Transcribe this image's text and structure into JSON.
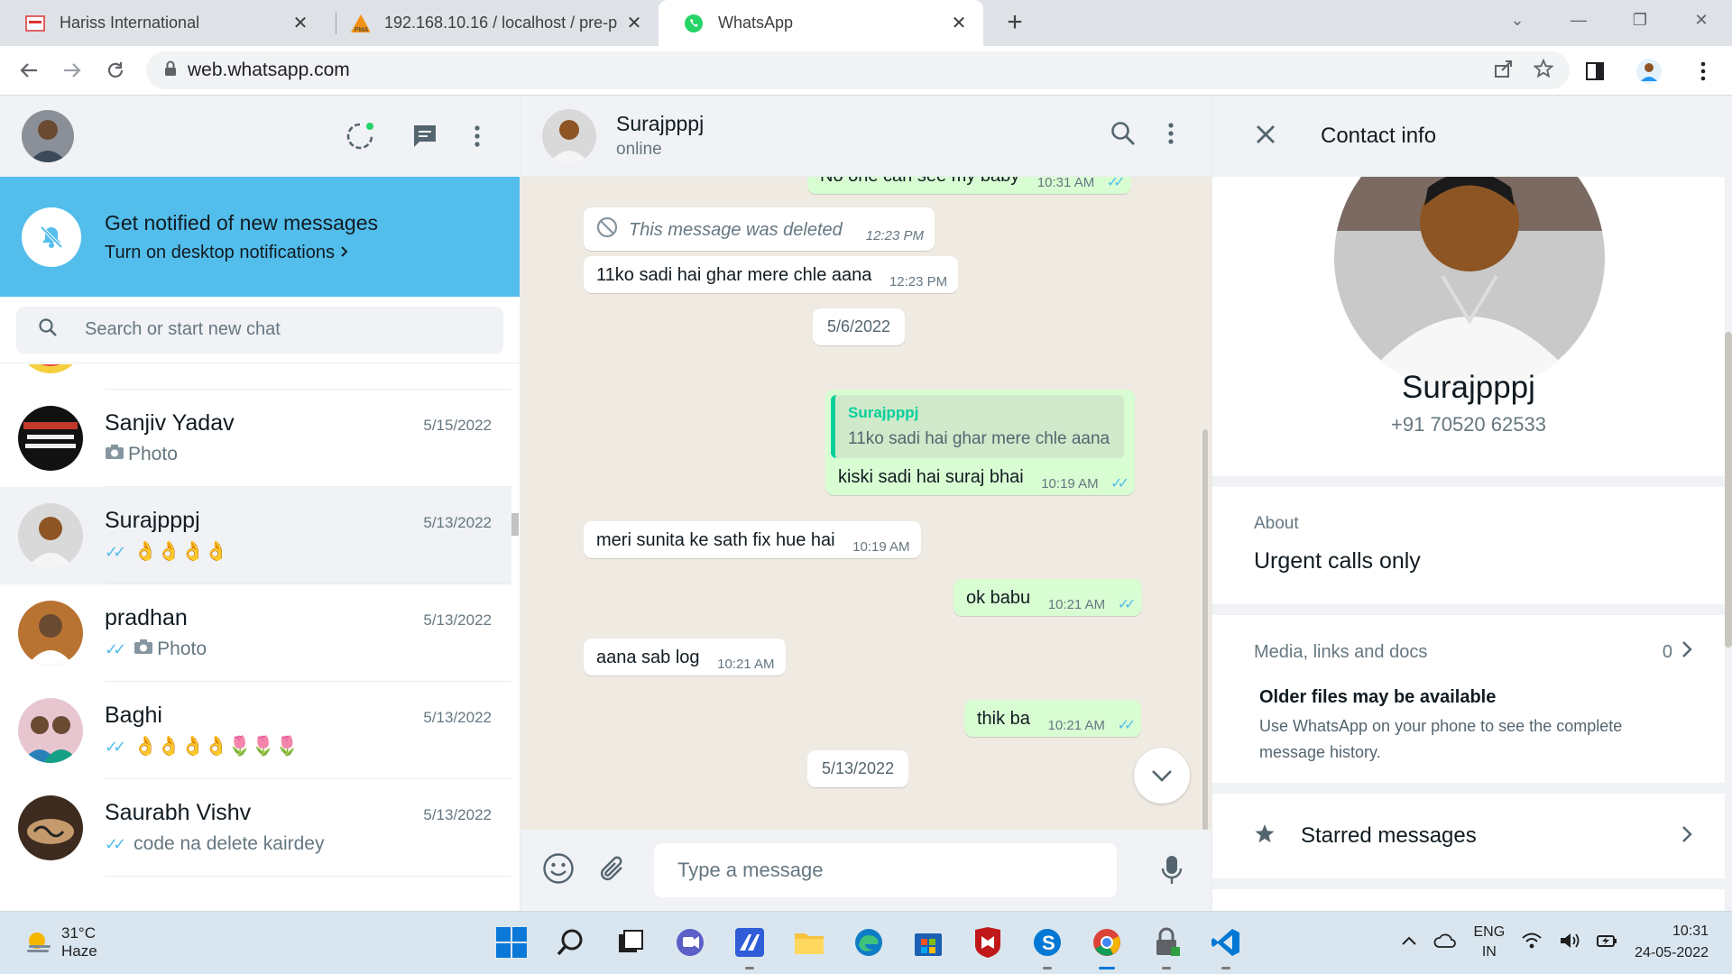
{
  "browser": {
    "tabs": [
      {
        "title": "Hariss International"
      },
      {
        "title": "192.168.10.16 / localhost / pre-p"
      },
      {
        "title": "WhatsApp"
      }
    ],
    "url": "web.whatsapp.com"
  },
  "notification": {
    "title": "Get notified of new messages",
    "link": "Turn on desktop notifications"
  },
  "search": {
    "placeholder": "Search or start new chat"
  },
  "chats": [
    {
      "name": "",
      "date": "",
      "last": "🤣",
      "ticks": false
    },
    {
      "name": "Sanjiv Yadav",
      "date": "5/15/2022",
      "last": "Photo",
      "ticks": false,
      "photo": true
    },
    {
      "name": "Surajpppj",
      "date": "5/13/2022",
      "last": "👌👌👌👌",
      "ticks": true,
      "active": true
    },
    {
      "name": "pradhan",
      "date": "5/13/2022",
      "last": "Photo",
      "ticks": true,
      "photo": true
    },
    {
      "name": "Baghi",
      "date": "5/13/2022",
      "last": "👌👌👌👌🌷🌷🌷",
      "ticks": true
    },
    {
      "name": "Saurabh Vishv",
      "date": "5/13/2022",
      "last": "code na delete kairdey",
      "ticks": true
    }
  ],
  "conversation": {
    "contact_name": "Surajpppj",
    "status": "online",
    "partial_top": {
      "text": "No one can see my baby",
      "time": "10:31 AM"
    },
    "messages": [
      {
        "dir": "in",
        "deleted": true,
        "text": "This message was deleted",
        "time": "12:23 PM"
      },
      {
        "dir": "in",
        "text": "11ko sadi hai ghar mere chle aana",
        "time": "12:23 PM"
      },
      {
        "dir": "date",
        "text": "5/6/2022"
      },
      {
        "dir": "out",
        "quote_name": "Surajpppj",
        "quote_text": "11ko sadi hai ghar mere chle aana",
        "text": "kiski sadi hai suraj bhai",
        "time": "10:19 AM"
      },
      {
        "dir": "in",
        "text": "meri sunita ke sath fix hue hai",
        "time": "10:19 AM"
      },
      {
        "dir": "out",
        "text": "ok babu",
        "time": "10:21 AM"
      },
      {
        "dir": "in",
        "text": "aana sab log",
        "time": "10:21 AM"
      },
      {
        "dir": "out",
        "text": "thik ba",
        "time": "10:21 AM"
      },
      {
        "dir": "date",
        "text": "5/13/2022"
      }
    ],
    "composer_placeholder": "Type a message"
  },
  "contact_info": {
    "title": "Contact info",
    "name": "Surajpppj",
    "phone": "+91 70520 62533",
    "about_label": "About",
    "about": "Urgent calls only",
    "media_label": "Media, links and docs",
    "media_count": "0",
    "older_title": "Older files may be available",
    "older_desc": "Use WhatsApp on your phone to see the complete message history.",
    "starred": "Starred messages"
  },
  "taskbar": {
    "temp": "31°C",
    "weather": "Haze",
    "lang1": "ENG",
    "lang2": "IN",
    "time": "10:31",
    "date": "24-05-2022"
  },
  "colors": {
    "notif_bg": "#53bdeb",
    "out_bubble": "#d9fdd3",
    "chat_bg": "#efeae2",
    "tick_blue": "#53bdeb",
    "accent_green": "#06cf9c"
  }
}
